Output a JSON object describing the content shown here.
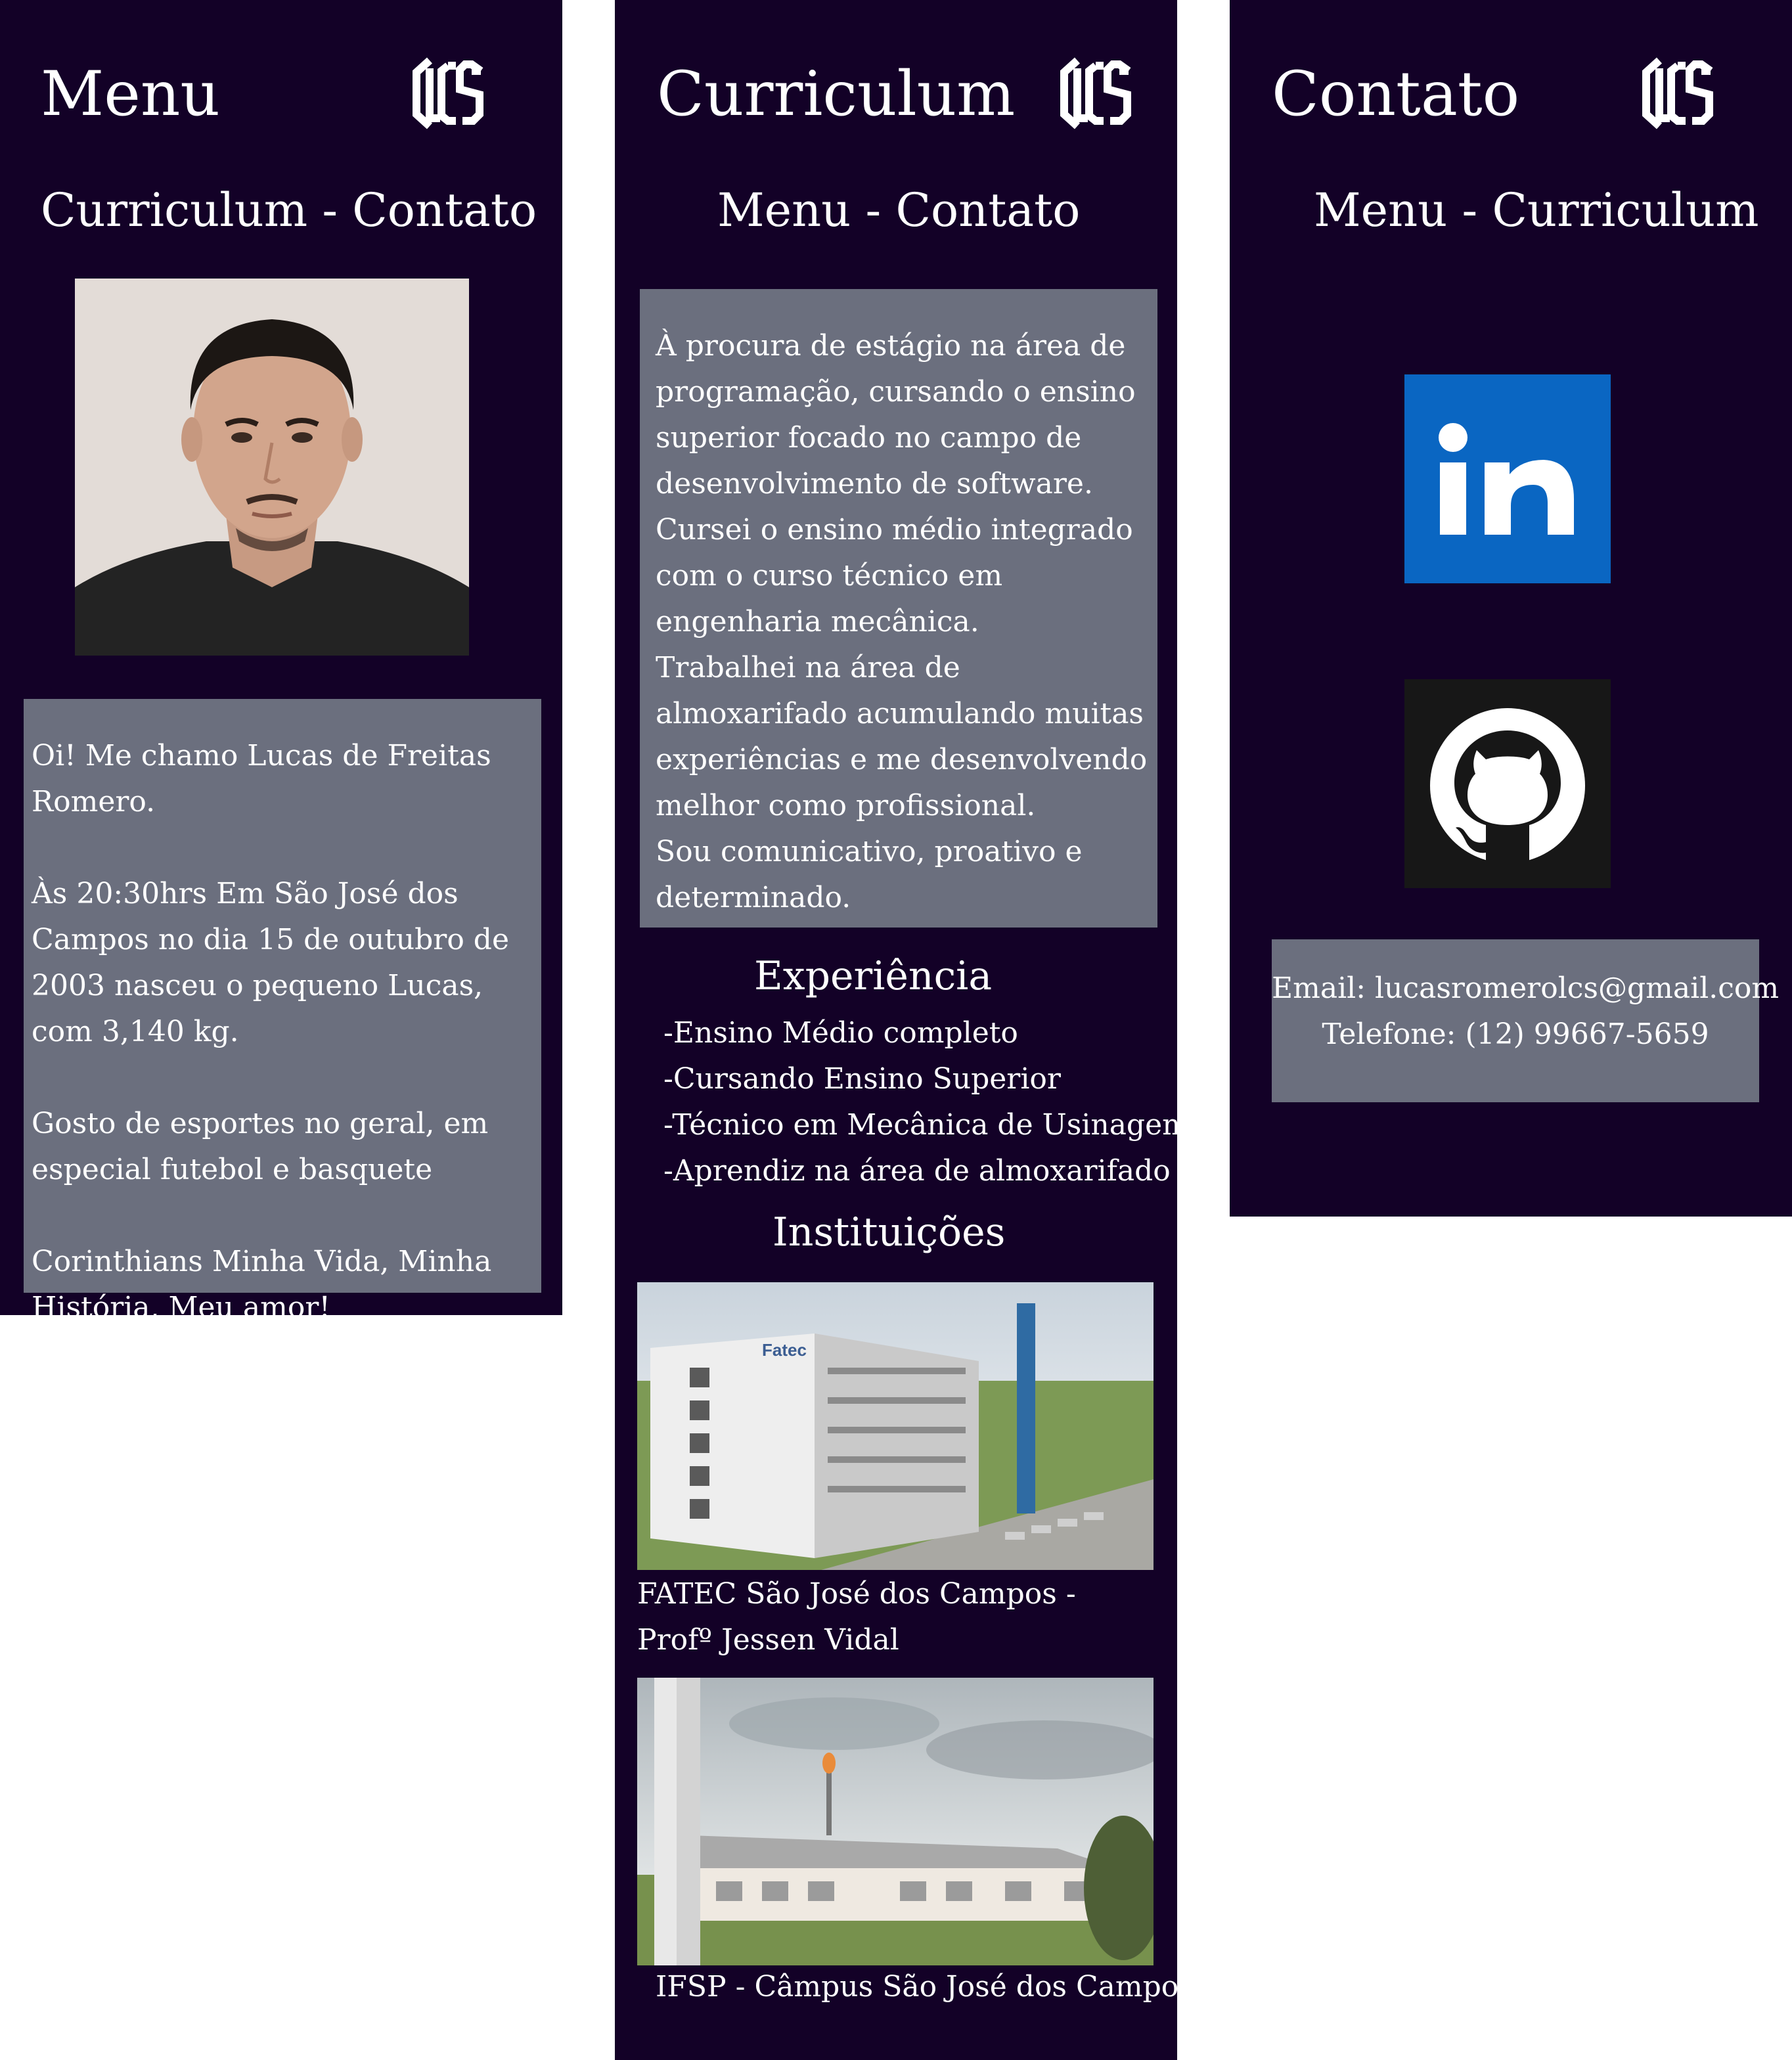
{
  "colors": {
    "panel_bg": "#130127",
    "card_bg": "#6b6f7e",
    "text": "#ffffff",
    "linkedin": "#0a66c2",
    "github_bg": "#171717"
  },
  "menu": {
    "title": "Menu",
    "logo_icon": "lcs-monogram-icon",
    "nav": {
      "link1": "Curriculum",
      "sep": " - ",
      "link2": "Contato"
    },
    "profile_photo": "profile-photo",
    "bio": "Oi!  Me chamo Lucas de Freitas Romero.\n\nÀs 20:30hrs Em São José dos Campos no dia 15 de outubro de 2003 nasceu o pequeno Lucas, com 3,140 kg.\n\nGosto de esportes no geral, em especial futebol e basquete\n\nCorinthians Minha Vida, Minha História, Meu amor!"
  },
  "curriculum": {
    "title": "Curriculum",
    "logo_icon": "lcs-monogram-icon",
    "nav": {
      "link1": "Menu",
      "sep": " - ",
      "link2": "Contato"
    },
    "summary": "À procura de estágio na área de programação, cursando o ensino superior focado no campo de desenvolvimento de software.\nCursei o ensino médio integrado com o curso técnico em engenharia mecânica.\nTrabalhei na área de almoxarifado acumulando muitas experiências e me desenvolvendo melhor como profissional.\nSou comunicativo, proativo e determinado.",
    "experience_heading": "Experiência",
    "experience": [
      "-Ensino Médio completo",
      "-Cursando Ensino Superior",
      "-Técnico em Mecânica de Usinagem",
      "-Aprendiz na área de almoxarifado"
    ],
    "institutions_heading": "Instituições",
    "institutions": [
      {
        "sign_text": "Fatec",
        "caption": "FATEC São José dos Campos - Profº Jessen Vidal"
      },
      {
        "caption": "IFSP - Câmpus São José dos Campos"
      }
    ]
  },
  "contato": {
    "title": "Contato",
    "logo_icon": "lcs-monogram-icon",
    "nav": {
      "link1": "Menu",
      "sep": " - ",
      "link2": "Curriculum"
    },
    "linkedin_icon": "linkedin-icon",
    "github_icon": "github-icon",
    "email": "Email: lucasromerolcs@gmail.com",
    "phone": "Telefone: (12) 99667-5659"
  }
}
